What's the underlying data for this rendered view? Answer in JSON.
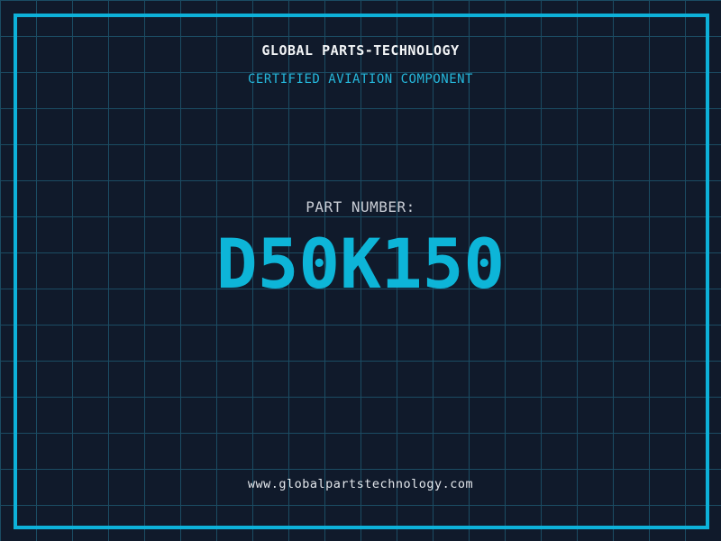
{
  "header": {
    "company_name": "GLOBAL PARTS-TECHNOLOGY",
    "certification_line": "CERTIFIED AVIATION COMPONENT"
  },
  "part": {
    "label": "PART NUMBER:",
    "number": "D50K150"
  },
  "footer": {
    "website": "www.globalpartstechnology.com"
  },
  "colors": {
    "background": "#101a2b",
    "grid_line": "#1b4c63",
    "border": "#0db1d9",
    "title": "#f2f4f6",
    "accent_cyan": "#25b7db",
    "label": "#c9cdd5",
    "part_number": "#0db5d8",
    "url": "#e3e7ec"
  }
}
